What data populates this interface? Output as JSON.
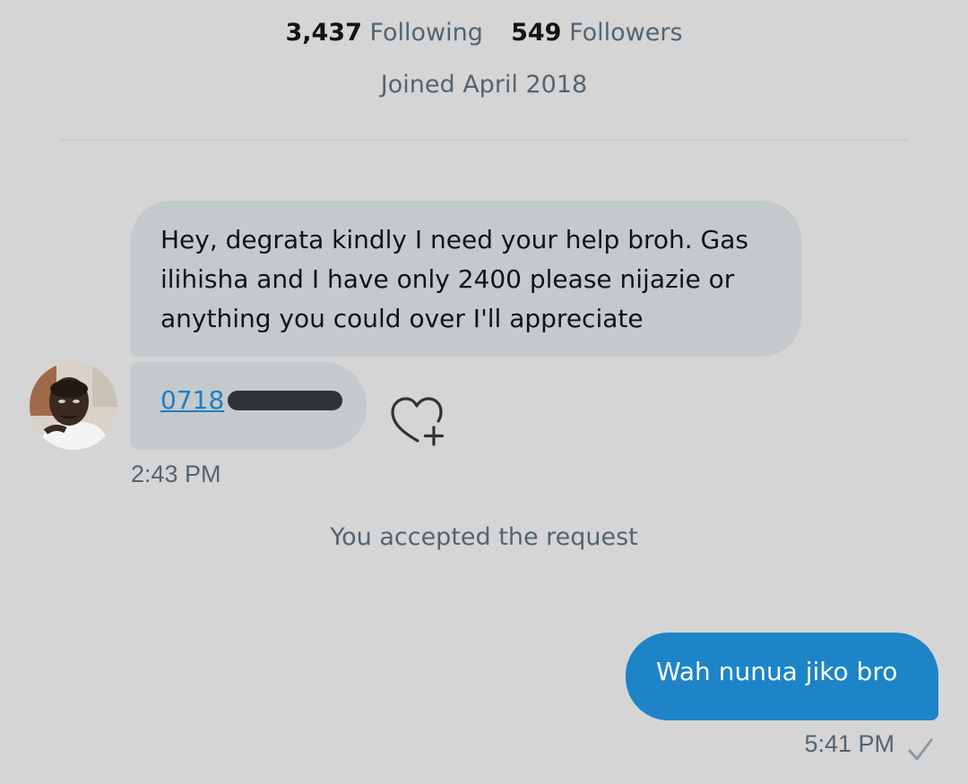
{
  "profile": {
    "following_count": "3,437",
    "following_label": "Following",
    "followers_count": "549",
    "followers_label": "Followers",
    "joined": "Joined April 2018"
  },
  "conversation": {
    "received": {
      "text": "Hey, degrata kindly I need your help broh. Gas ilihisha and I have only 2400 please nijazie or anything you could over I'll appreciate",
      "phone_visible": "0718",
      "phone_redacted": true,
      "time": "2:43 PM"
    },
    "system_message": "You accepted the request",
    "sent": {
      "text": "Wah nunua jiko bro",
      "time": "5:41 PM",
      "status_icon": "checkmark-icon"
    }
  },
  "icons": {
    "avatar": "user-avatar",
    "reaction": "heart-plus-icon",
    "delivered": "checkmark-icon"
  },
  "colors": {
    "background": "#d5d5d5",
    "received_bubble": "#c4c9cc",
    "sent_bubble": "#1d84c8",
    "link": "#1d7fc4",
    "secondary_text": "#536471"
  }
}
